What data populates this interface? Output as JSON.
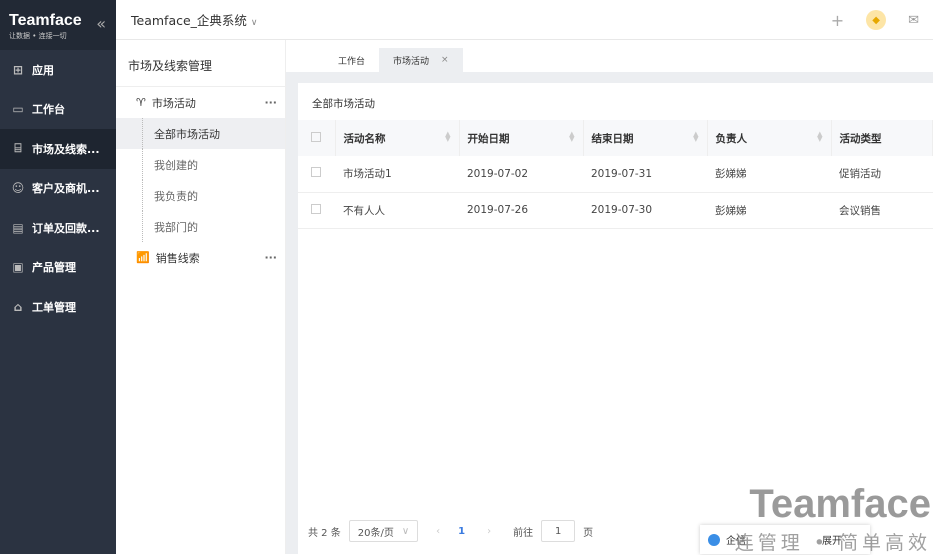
{
  "brand": {
    "name": "Teamface",
    "slogan": "让数据 • 连接一切"
  },
  "sidebar": [
    {
      "label": "应用",
      "icon": "grid-icon"
    },
    {
      "label": "工作台",
      "icon": "monitor-icon"
    },
    {
      "label": "市场及线索...",
      "icon": "store-icon"
    },
    {
      "label": "客户及商机...",
      "icon": "users-icon"
    },
    {
      "label": "订单及回款...",
      "icon": "order-icon"
    },
    {
      "label": "产品管理",
      "icon": "product-icon"
    },
    {
      "label": "工单管理",
      "icon": "ticket-icon"
    }
  ],
  "header": {
    "company": "Teamface_企典系统"
  },
  "submenu": {
    "title": "市场及线索管理",
    "group1": "市场活动",
    "items": [
      "全部市场活动",
      "我创建的",
      "我负责的",
      "我部门的"
    ],
    "group2": "销售线索"
  },
  "tabs": [
    {
      "label": "工作台"
    },
    {
      "label": "市场活动"
    }
  ],
  "card": {
    "title": "全部市场活动"
  },
  "table": {
    "headers": [
      "活动名称",
      "开始日期",
      "结束日期",
      "负责人",
      "活动类型"
    ],
    "rows": [
      [
        "市场活动1",
        "2019-07-02",
        "2019-07-31",
        "彭娣娣",
        "促销活动"
      ],
      [
        "不有人人",
        "2019-07-26",
        "2019-07-30",
        "彭娣娣",
        "会议销售"
      ]
    ]
  },
  "pagination": {
    "total": "共 2 条",
    "page_size": "20条/页",
    "current": "1",
    "goto_label": "前往",
    "goto_value": "1",
    "page_suffix": "页"
  },
  "watermark": {
    "title": "Teamface",
    "slogan": "连管理 • 简单高效"
  },
  "chat": {
    "label": "企信",
    "expand": "展开"
  }
}
